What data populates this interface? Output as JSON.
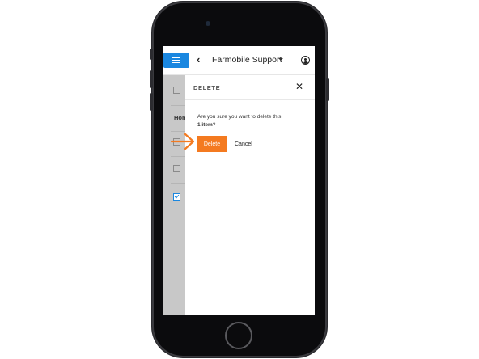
{
  "app": {
    "title": "Farmobile Support"
  },
  "background": {
    "text_partial": "Hom"
  },
  "dialog": {
    "title": "DELETE",
    "message_prefix": "Are you sure you want to delete this",
    "message_count": "1 item",
    "message_suffix": "?",
    "delete_label": "Delete",
    "cancel_label": "Cancel"
  },
  "colors": {
    "accent_blue": "#1a87e0",
    "delete_orange": "#f47a20",
    "arrow_orange": "#f47a20"
  },
  "icons": {
    "menu": "hamburger-icon",
    "back": "chevron-left-icon",
    "dropdown": "caret-down-icon",
    "user": "user-circle-icon",
    "close": "close-icon",
    "pointer": "arrow-right-icon"
  }
}
